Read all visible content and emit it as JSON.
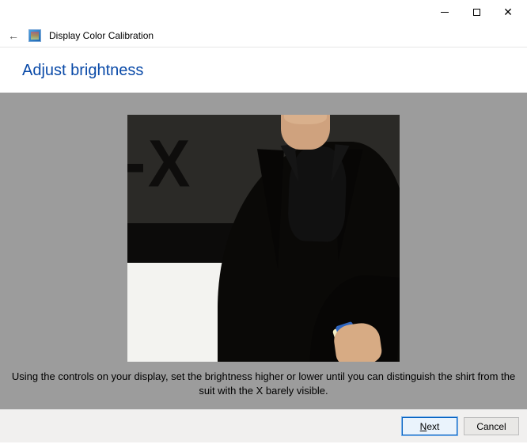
{
  "window": {
    "app_title": "Display Color Calibration"
  },
  "page": {
    "heading": "Adjust brightness",
    "instruction": "Using the controls on your display, set the brightness higher or lower until you can distinguish the shirt from the suit with the X barely visible."
  },
  "buttons": {
    "next_prefix": "N",
    "next_rest": "ext",
    "cancel": "Cancel"
  }
}
